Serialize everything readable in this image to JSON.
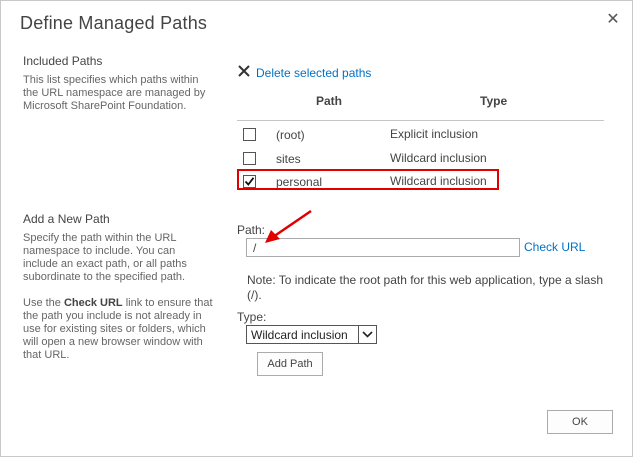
{
  "dialog": {
    "title": "Define Managed Paths",
    "close_glyph": "✕"
  },
  "included": {
    "title": "Included Paths",
    "description": "This list specifies which paths within the URL namespace are managed by Microsoft SharePoint Foundation.",
    "delete_label": "Delete selected paths",
    "delete_icon": "x-icon",
    "headers": {
      "path": "Path",
      "type": "Type"
    },
    "rows": [
      {
        "path": "(root)",
        "type": "Explicit inclusion",
        "checked": false
      },
      {
        "path": "sites",
        "type": "Wildcard inclusion",
        "checked": false
      },
      {
        "path": "personal",
        "type": "Wildcard inclusion",
        "checked": true
      }
    ]
  },
  "add_new": {
    "title": "Add a New Path",
    "desc1": "Specify the path within the URL namespace to include. You can include an exact path, or all paths subordinate to the specified path.",
    "desc2_pre": "Use the ",
    "desc2_bold": "Check URL",
    "desc2_post": " link to ensure that the path you include is not already in use for existing sites or folders, which will open a new browser window with that URL.",
    "path_label": "Path:",
    "path_value": "/",
    "check_url": "Check URL",
    "note": "Note: To indicate the root path for this web application, type a slash (/).",
    "type_label": "Type:",
    "type_value": "Wildcard inclusion",
    "add_button": "Add Path"
  },
  "footer": {
    "ok_label": "OK"
  },
  "colors": {
    "link": "#0072c6",
    "highlight": "#e00000",
    "text": "#444444"
  }
}
